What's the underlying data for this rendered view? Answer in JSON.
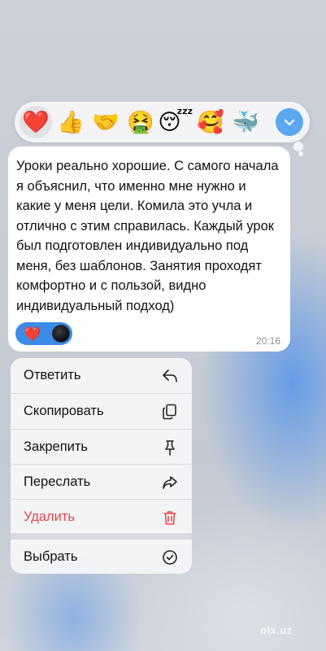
{
  "reactions": [
    {
      "emoji": "❤️",
      "name": "heart",
      "selected": true
    },
    {
      "emoji": "👍",
      "name": "thumbs-up"
    },
    {
      "emoji": "🤝",
      "name": "handshake"
    },
    {
      "emoji": "🤮",
      "name": "vomiting-face"
    },
    {
      "emoji": "😴",
      "name": "sleeping-face"
    },
    {
      "emoji": "🥰",
      "name": "smiling-face-with-hearts"
    },
    {
      "emoji": "🐳",
      "name": "whale"
    }
  ],
  "message": {
    "text": "Уроки реально хорошие. С самого начала я объяснил, что именно мне нужно и какие у меня цели. Комила это учла и отлично с этим справилась. Каждый урок был подготовлен индивидуально под меня, без шаблонов. Занятия проходят комфортно и с пользой, видно индивидуальный подход)",
    "time": "20:16",
    "reaction_emoji": "❤️"
  },
  "menu": {
    "reply": "Ответить",
    "copy": "Скопировать",
    "pin": "Закрепить",
    "forward": "Переслать",
    "delete": "Удалить",
    "select": "Выбрать"
  },
  "colors": {
    "accent": "#5ca7ee",
    "reaction_pill": "#3c8ce7",
    "danger": "#e5484d"
  },
  "watermark": "olx.uz"
}
